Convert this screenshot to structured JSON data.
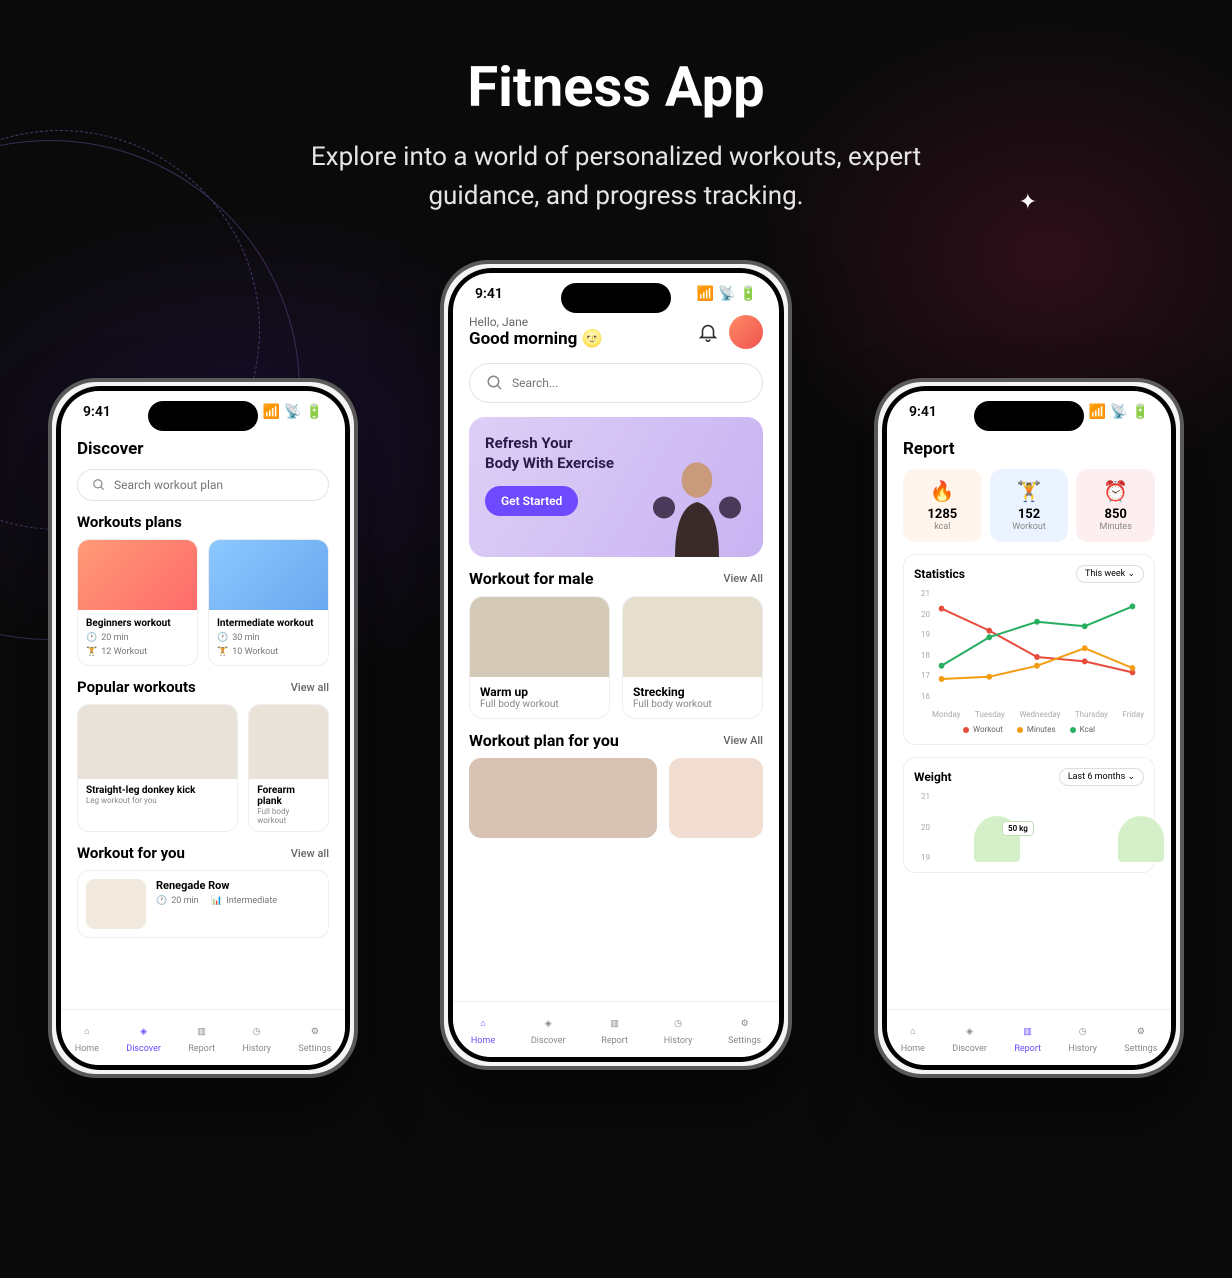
{
  "hero": {
    "title": "Fitness App",
    "subtitle": "Explore into a world of personalized workouts, expert guidance, and progress tracking."
  },
  "status": {
    "time": "9:41"
  },
  "nav": {
    "home": "Home",
    "discover": "Discover",
    "report": "Report",
    "history": "History",
    "settings": "Settings"
  },
  "discover": {
    "title": "Discover",
    "search_placeholder": "Search workout plan",
    "workouts_plans": "Workouts plans",
    "plan1": {
      "title": "Beginners workout",
      "duration": "20 min",
      "count": "12 Workout"
    },
    "plan2": {
      "title": "Intermediate workout",
      "duration": "30 min",
      "count": "10 Workout"
    },
    "popular": "Popular workouts",
    "view_all": "View all",
    "pop1": {
      "title": "Straight-leg donkey kick",
      "sub": "Leg workout for you"
    },
    "pop2": {
      "title": "Forearm plank",
      "sub": "Full body workout"
    },
    "wfy": "Workout for you",
    "wfy1": {
      "title": "Renegade Row",
      "duration": "20 min",
      "level": "Intermediate"
    }
  },
  "home": {
    "hello": "Hello, Jane",
    "greeting": "Good morning 🌝",
    "search_placeholder": "Search...",
    "hero_line1": "Refresh Your",
    "hero_line2": "Body With  Exercise",
    "hero_cta": "Get Started",
    "workout_male": "Workout for male",
    "view_all": "View All",
    "wm1": {
      "title": "Warm up",
      "sub": "Full body workout"
    },
    "wm2": {
      "title": "Strecking",
      "sub": "Full body workout"
    },
    "workout_plan": "Workout plan for you"
  },
  "report": {
    "title": "Report",
    "stat1": {
      "icon": "🔥",
      "value": "1285",
      "label": "kcal"
    },
    "stat2": {
      "icon": "🏋️",
      "value": "152",
      "label": "Workout"
    },
    "stat3": {
      "icon": "⏰",
      "value": "850",
      "label": "Minutes"
    },
    "statistics": "Statistics",
    "range1": "This week",
    "legend": {
      "workout": "Workout",
      "minutes": "Minutes",
      "kcal": "Kcal"
    },
    "weight": "Weight",
    "range2": "Last 6 months",
    "weight_badge": "50 kg"
  },
  "chart_data": {
    "type": "line",
    "categories": [
      "Monday",
      "Tuesday",
      "Wednesday",
      "Thursday",
      "Friday"
    ],
    "ylim": [
      16,
      21
    ],
    "y_ticks": [
      21,
      20,
      19,
      18,
      17,
      16
    ],
    "series": [
      {
        "name": "Workout",
        "color": "#e74c3c",
        "values": [
          20.2,
          19.2,
          18.0,
          17.8,
          17.3
        ]
      },
      {
        "name": "Minutes",
        "color": "#f39c12",
        "values": [
          17.0,
          17.1,
          17.6,
          18.4,
          17.5
        ]
      },
      {
        "name": "Kcal",
        "color": "#27ae60",
        "values": [
          17.6,
          18.9,
          19.6,
          19.4,
          20.3
        ]
      }
    ]
  },
  "weight_chart": {
    "type": "area",
    "ylim": [
      18,
      21
    ],
    "y_ticks": [
      21,
      20,
      19
    ],
    "badge": "50 kg"
  }
}
